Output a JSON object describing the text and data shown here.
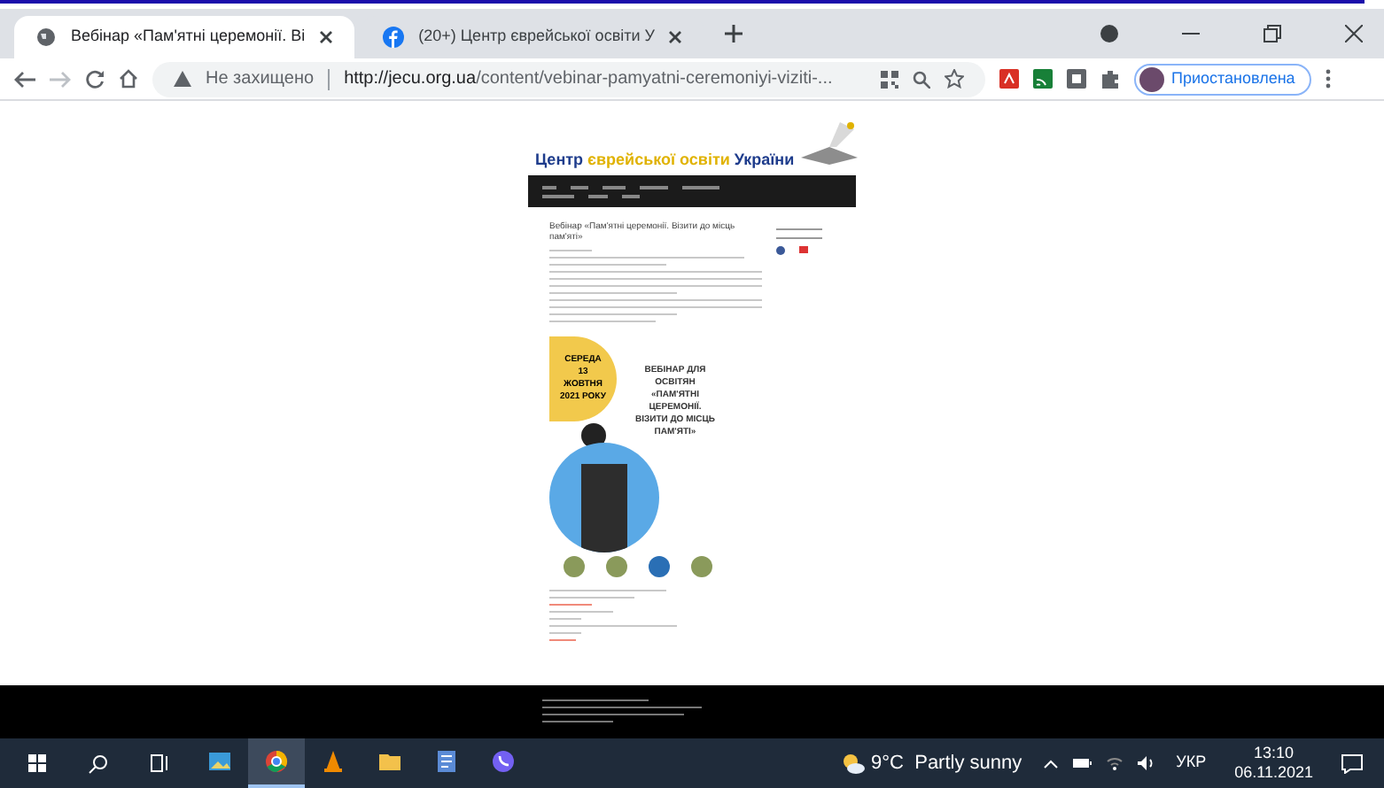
{
  "tabs": [
    {
      "title": "Вебінар «Пам'ятні церемонії. Ві",
      "selected": true
    },
    {
      "title": "(20+) Центр єврейської освіти У",
      "selected": false
    }
  ],
  "address_bar": {
    "security": "Не захищено",
    "url_host": "http://jecu.org.ua",
    "url_path": "/content/vebinar-pamyatni-ceremoniyi-viziti-...",
    "profile": "Приостановлена"
  },
  "site": {
    "title_parts": [
      "Центр ",
      "єврейської освіти",
      " України"
    ],
    "article_title": "Вебінар «Пам'ятні церемонії. Візити до місць пам'яті»",
    "poster": {
      "date_lines": [
        "СЕРЕДА",
        "13",
        "ЖОВТНЯ",
        "2021 РОКУ"
      ],
      "heading_lines": [
        "ВЕБІНАР ДЛЯ",
        "ОСВІТЯН",
        "«ПАМ'ЯТНІ",
        "ЦЕРЕМОНІЇ.",
        "ВІЗИТИ ДО МІСЦЬ",
        "ПАМ'ЯТІ»"
      ]
    }
  },
  "taskbar": {
    "apps": [
      {
        "kind": "photos",
        "active": false
      },
      {
        "kind": "chrome",
        "active": true
      },
      {
        "kind": "vlc",
        "active": false
      },
      {
        "kind": "folder",
        "active": false
      },
      {
        "kind": "document",
        "active": false
      },
      {
        "kind": "viber",
        "active": false
      }
    ],
    "weather": "9°C  Partly sunny",
    "language": "УКР",
    "time": "13:10",
    "date": "06.11.2021"
  }
}
